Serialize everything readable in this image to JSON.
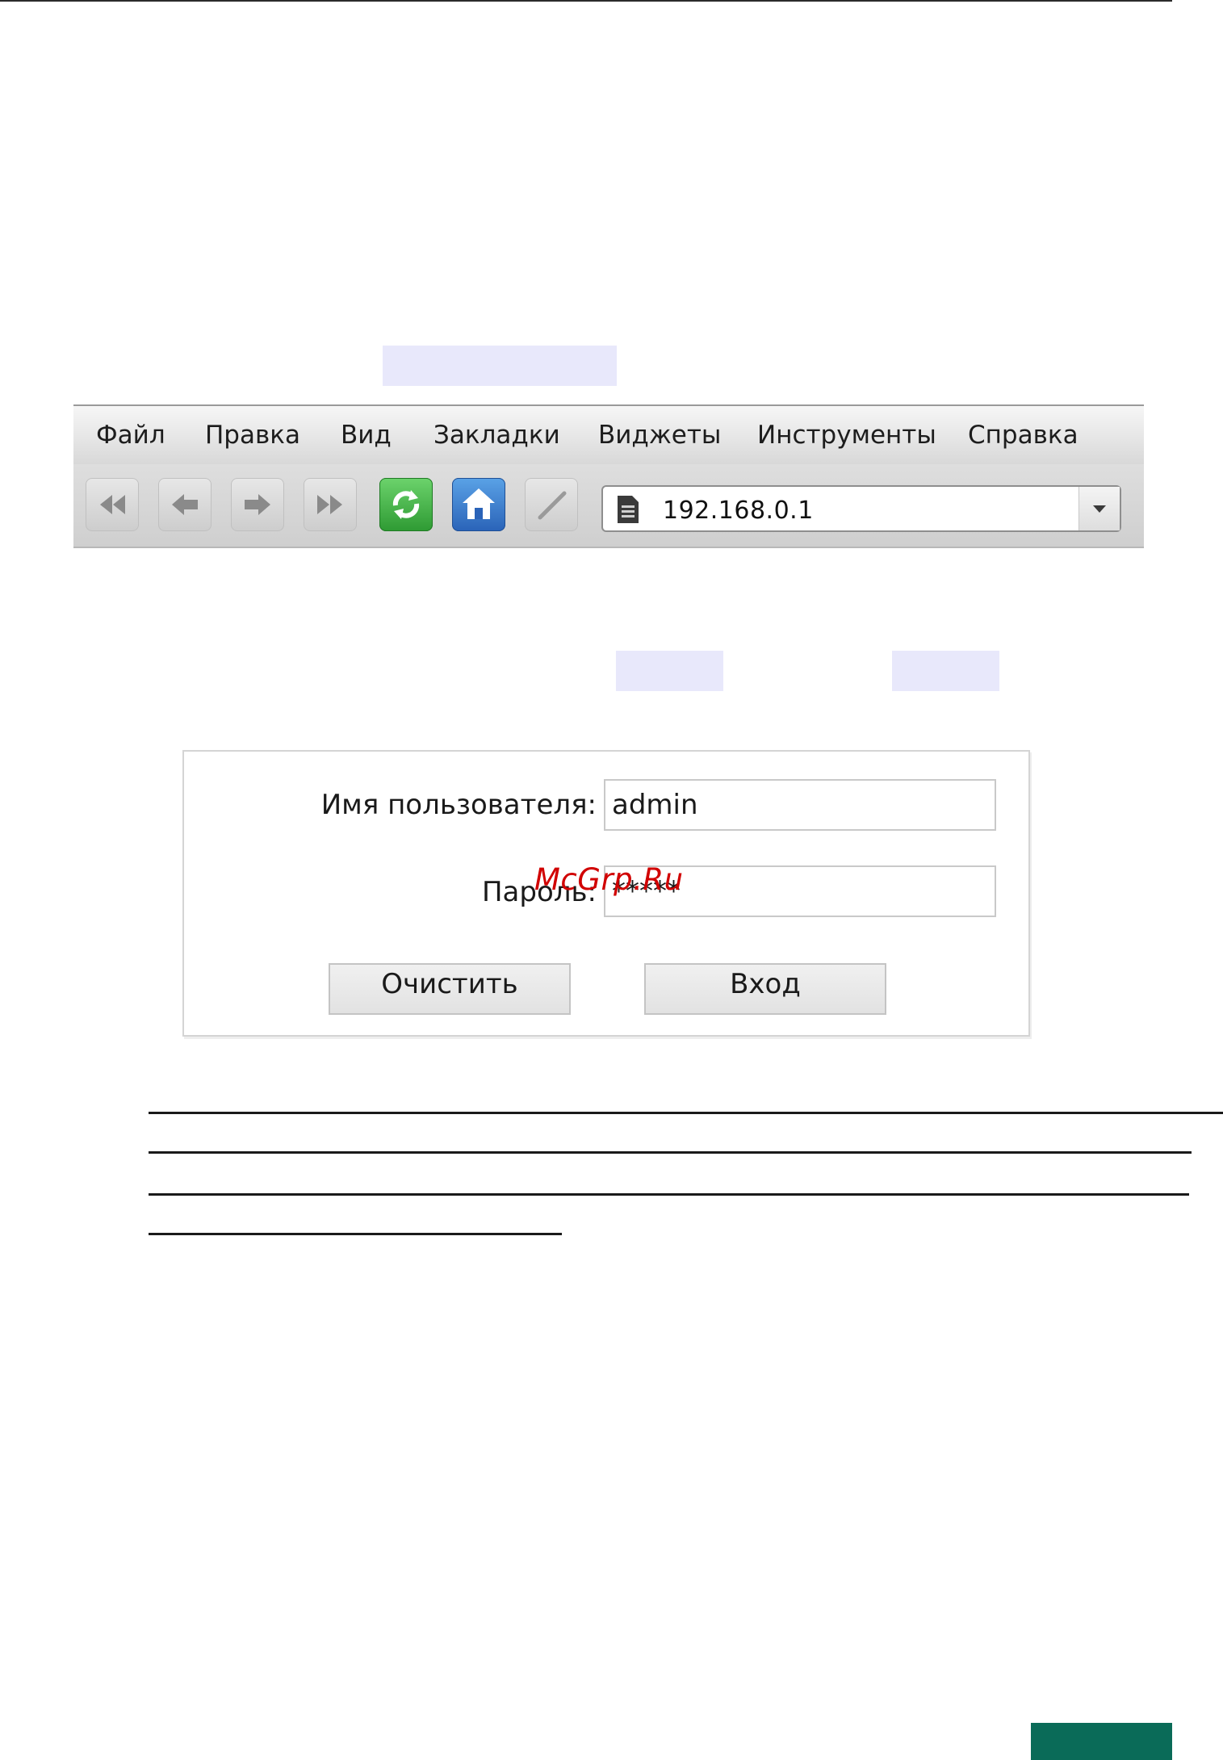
{
  "browser": {
    "menu": [
      "Файл",
      "Правка",
      "Вид",
      "Закладки",
      "Виджеты",
      "Инструменты",
      "Справка"
    ],
    "toolbar_icons": [
      "rewind-icon",
      "back-icon",
      "forward-icon",
      "fast-forward-icon",
      "reload-icon",
      "home-icon",
      "edit-icon"
    ],
    "address": {
      "url": "192.168.0.1",
      "page_icon": "page-icon",
      "dropdown_icon": "chevron-down-icon"
    }
  },
  "login": {
    "username_label": "Имя пользователя:",
    "username_value": "admin",
    "password_label": "Пароль:",
    "password_value": "*****",
    "clear_button": "Очистить",
    "login_button": "Вход"
  },
  "watermark": "McGrp.Ru",
  "colors": {
    "highlight": "#e8e8fb",
    "page_tab": "#0a6b58",
    "watermark": "#d10000"
  }
}
